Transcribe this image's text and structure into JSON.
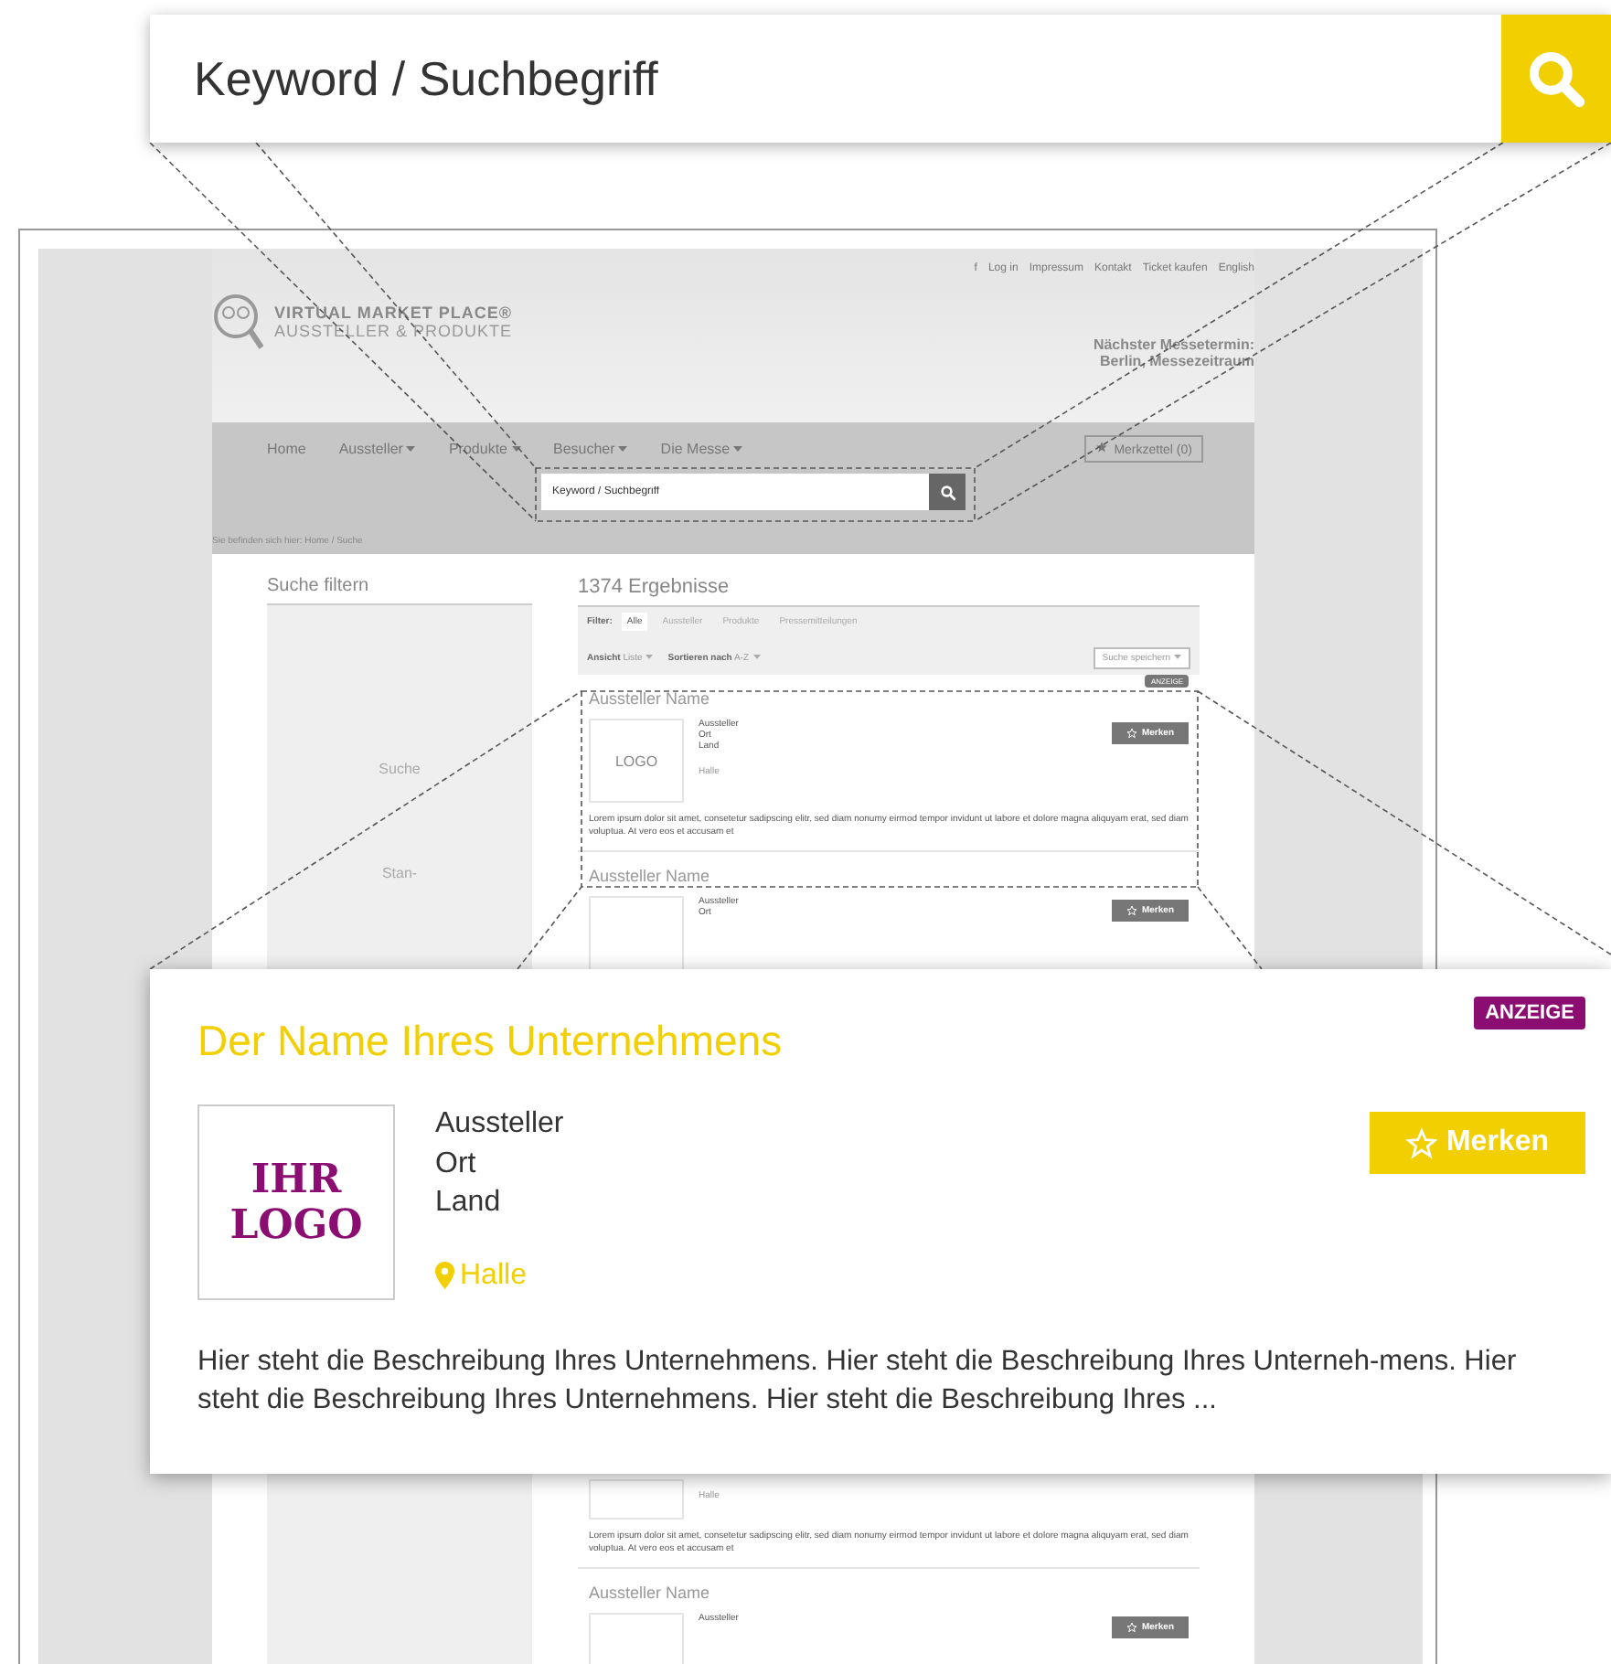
{
  "search_overlay": {
    "placeholder": "Keyword / Suchbegriff"
  },
  "mockup": {
    "top_links": [
      "f",
      "Log in",
      "Impressum",
      "Kontakt",
      "Ticket kaufen",
      "English"
    ],
    "logo": {
      "title": "VIRTUAL MARKET PLACE®",
      "subtitle": "AUSSTELLER & PRODUKTE"
    },
    "next_date": [
      "Nächster Messetermin:",
      "Berlin, Messezeitraum"
    ],
    "nav": [
      "Home",
      "Aussteller",
      "Produkte",
      "Besucher",
      "Die Messe"
    ],
    "watchlist": "Merkzettel (0)",
    "search": {
      "placeholder": "Keyword / Suchbegriff"
    },
    "breadcrumb": "Sie befinden sich hier:  Home / Suche",
    "sidebar": {
      "title": "Suche filtern",
      "labels": [
        "Suche",
        "Stan-"
      ]
    },
    "results_title": "1374 Ergebnisse",
    "filter_label": "Filter:",
    "filters": [
      {
        "label": "Alle",
        "selected": true
      },
      {
        "label": "Aussteller",
        "selected": false
      },
      {
        "label": "Produkte",
        "selected": false
      },
      {
        "label": "Pressemitteilungen",
        "selected": false
      }
    ],
    "view": {
      "label": "Ansicht",
      "value": "Liste"
    },
    "sort": {
      "label": "Sortieren nach",
      "value": "A-Z"
    },
    "save_search": "Suche speichern",
    "results": [
      {
        "kind": "full",
        "badge": "ANZEIGE",
        "name": "Aussteller Name",
        "logo": "LOGO",
        "lines": [
          "Aussteller",
          "Ort",
          "Land"
        ],
        "hall": "Halle",
        "button": "Merken",
        "text": "Lorem ipsum dolor sit amet, consetetur sadipscing elitr, sed diam nonumy eirmod tempor invidunt ut labore et dolore magna aliquyam erat, sed diam voluptua. At vero eos et accusam et"
      },
      {
        "kind": "head",
        "name": "Aussteller Name",
        "lines": [
          "Aussteller",
          "Ort"
        ],
        "button": "Merken"
      },
      {
        "kind": "tail",
        "hall": "Halle",
        "text": "Lorem ipsum dolor sit amet, consetetur sadipscing elitr, sed diam nonumy eirmod tempor invidunt ut labore et dolore magna aliquyam erat, sed diam voluptua. At vero eos et accusam et"
      },
      {
        "kind": "head",
        "name": "Aussteller Name",
        "lines": [
          "Aussteller"
        ],
        "button": "Merken"
      }
    ]
  },
  "card": {
    "badge": "ANZEIGE",
    "title": "Der Name Ihres Unternehmens",
    "logo": [
      "IHR",
      "LOGO"
    ],
    "lines": [
      "Aussteller",
      "Ort",
      "Land"
    ],
    "hall": "Halle",
    "button": "Merken",
    "text": "Hier steht die Beschreibung Ihres Unternehmens. Hier steht die Beschreibung Ihres Unterneh-mens. Hier steht die Beschreibung Ihres Unternehmens. Hier steht die Beschreibung Ihres ..."
  }
}
